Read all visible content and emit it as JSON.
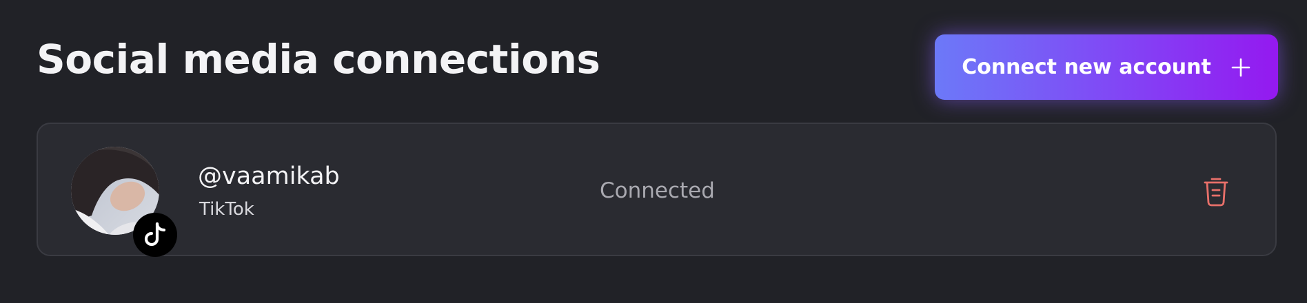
{
  "header": {
    "title": "Social media connections",
    "connect_button_label": "Connect new account"
  },
  "icons": {
    "plus": "plus-icon",
    "tiktok": "tiktok-icon",
    "trash": "trash-icon"
  },
  "accounts": [
    {
      "handle": "@vaamikab",
      "platform": "TikTok",
      "status": "Connected"
    }
  ],
  "colors": {
    "background": "#212227",
    "card": "#2a2b31",
    "button_gradient_start": "#6c79f8",
    "button_gradient_end": "#9419f0",
    "delete_icon": "#e8706a",
    "status_text": "#a9a9b0"
  }
}
